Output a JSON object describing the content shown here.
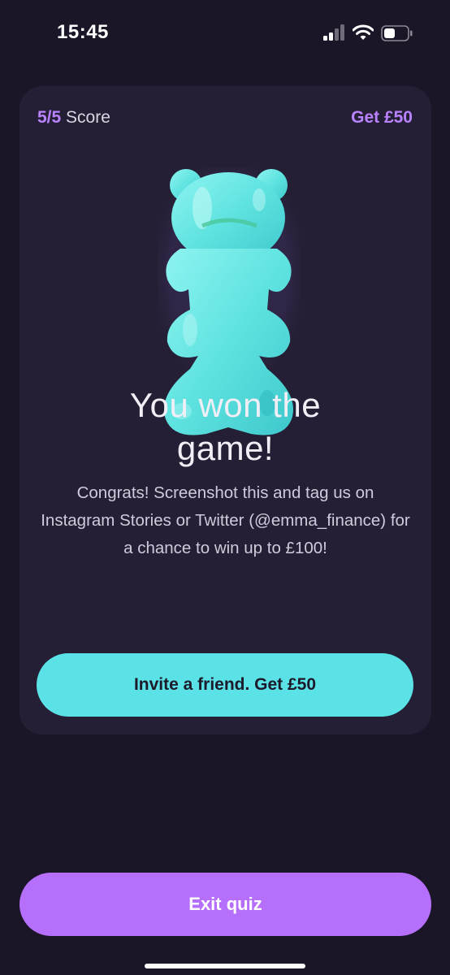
{
  "status_bar": {
    "time": "15:45",
    "signal_icon": "cellular-signal-icon",
    "wifi_icon": "wifi-icon",
    "battery_icon": "battery-icon"
  },
  "card": {
    "score_value": "5/5",
    "score_label": "Score",
    "reward": "Get £50",
    "image_icon": "gummy-bear-icon",
    "title": "You won the game!",
    "message": "Congrats! Screenshot this and tag us on Instagram Stories or Twitter (@emma_finance) for a chance to win up to £100!",
    "invite_button": "Invite a friend. Get £50"
  },
  "exit_button": "Exit quiz",
  "colors": {
    "background": "#1a1527",
    "card": "#241f35",
    "accent_purple": "#b982ff",
    "exit_button": "#b66ffb",
    "invite_button": "#5ae2e6"
  }
}
